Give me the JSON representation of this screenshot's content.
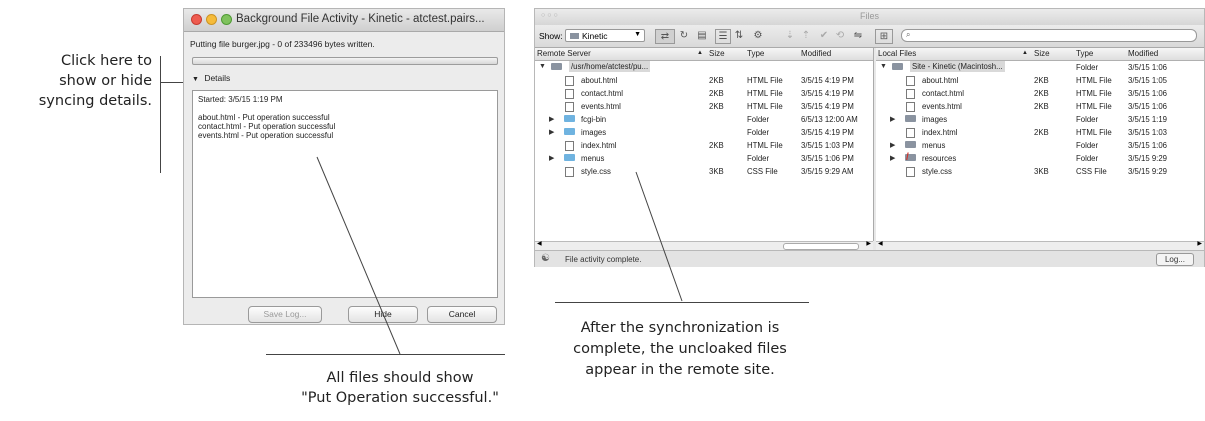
{
  "callouts": {
    "left": [
      "Click here to",
      "show or hide",
      "syncing details."
    ],
    "bottom_left": [
      "All files should show",
      "\"Put Operation successful.\""
    ],
    "bottom_right": [
      "After the synchronization is",
      "complete, the uncloaked files",
      "appear in the remote site."
    ]
  },
  "bg_window": {
    "title": "Background File Activity - Kinetic - atctest.pairs...",
    "status": "Putting file burger.jpg - 0 of 233496 bytes written.",
    "details_label": "Details",
    "log": [
      "Started: 3/5/15 1:19 PM",
      "",
      "about.html - Put operation successful",
      "contact.html - Put operation successful",
      "events.html - Put operation successful"
    ],
    "buttons": {
      "save_log": "Save Log...",
      "hide": "Hide",
      "cancel": "Cancel"
    }
  },
  "files_panel": {
    "title": "Files",
    "show_label": "Show:",
    "site_select": "Kinetic",
    "remote": {
      "headers": {
        "name": "Remote Server",
        "size": "Size",
        "type": "Type",
        "modified": "Modified"
      },
      "root": "/usr/home/atctest/pu...",
      "rows": [
        {
          "name": "about.html",
          "size": "2KB",
          "type": "HTML File",
          "modified": "3/5/15 4:19 PM",
          "kind": "file"
        },
        {
          "name": "contact.html",
          "size": "2KB",
          "type": "HTML File",
          "modified": "3/5/15 4:19 PM",
          "kind": "file"
        },
        {
          "name": "events.html",
          "size": "2KB",
          "type": "HTML File",
          "modified": "3/5/15 4:19 PM",
          "kind": "file"
        },
        {
          "name": "fcgi-bin",
          "size": "",
          "type": "Folder",
          "modified": "6/5/13 12:00 AM",
          "kind": "folder"
        },
        {
          "name": "images",
          "size": "",
          "type": "Folder",
          "modified": "3/5/15 4:19 PM",
          "kind": "folder"
        },
        {
          "name": "index.html",
          "size": "2KB",
          "type": "HTML File",
          "modified": "3/5/15 1:03 PM",
          "kind": "file"
        },
        {
          "name": "menus",
          "size": "",
          "type": "Folder",
          "modified": "3/5/15 1:06 PM",
          "kind": "folder"
        },
        {
          "name": "style.css",
          "size": "3KB",
          "type": "CSS File",
          "modified": "3/5/15 9:29 AM",
          "kind": "file"
        }
      ]
    },
    "local": {
      "headers": {
        "name": "Local Files",
        "size": "Size",
        "type": "Type",
        "modified": "Modified"
      },
      "root": "Site - Kinetic (Macintosh...",
      "root_type": "Folder",
      "root_modified": "3/5/15 1:06",
      "rows": [
        {
          "name": "about.html",
          "size": "2KB",
          "type": "HTML File",
          "modified": "3/5/15 1:05",
          "kind": "file"
        },
        {
          "name": "contact.html",
          "size": "2KB",
          "type": "HTML File",
          "modified": "3/5/15 1:06",
          "kind": "file"
        },
        {
          "name": "events.html",
          "size": "2KB",
          "type": "HTML File",
          "modified": "3/5/15 1:06",
          "kind": "file"
        },
        {
          "name": "images",
          "size": "",
          "type": "Folder",
          "modified": "3/5/15 1:19",
          "kind": "folder-dark"
        },
        {
          "name": "index.html",
          "size": "2KB",
          "type": "HTML File",
          "modified": "3/5/15 1:03",
          "kind": "file"
        },
        {
          "name": "menus",
          "size": "",
          "type": "Folder",
          "modified": "3/5/15 1:06",
          "kind": "folder-dark"
        },
        {
          "name": "resources",
          "size": "",
          "type": "Folder",
          "modified": "3/5/15 9:29",
          "kind": "folder-cloaked"
        },
        {
          "name": "style.css",
          "size": "3KB",
          "type": "CSS File",
          "modified": "3/5/15 9:29",
          "kind": "file"
        }
      ]
    },
    "status_text": "File activity complete.",
    "log_button": "Log..."
  }
}
